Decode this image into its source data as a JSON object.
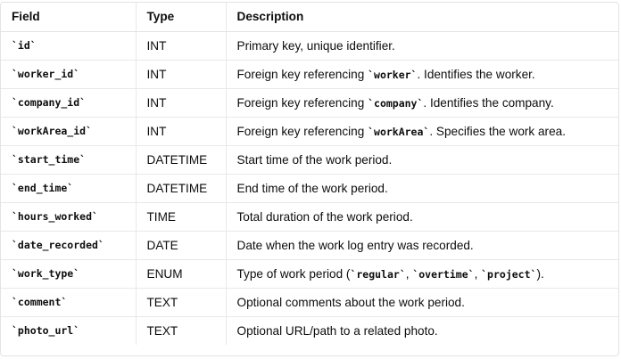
{
  "headers": {
    "field": "Field",
    "type": "Type",
    "description": "Description"
  },
  "rows": [
    {
      "field": "`id`",
      "type": "INT",
      "desc_parts": [
        {
          "t": "Primary key, unique identifier."
        }
      ]
    },
    {
      "field": "`worker_id`",
      "type": "INT",
      "desc_parts": [
        {
          "t": "Foreign key referencing "
        },
        {
          "t": "`worker`",
          "code": true
        },
        {
          "t": ". Identifies the worker."
        }
      ]
    },
    {
      "field": "`company_id`",
      "type": "INT",
      "desc_parts": [
        {
          "t": "Foreign key referencing "
        },
        {
          "t": "`company`",
          "code": true
        },
        {
          "t": ". Identifies the company."
        }
      ]
    },
    {
      "field": "`workArea_id`",
      "type": "INT",
      "desc_parts": [
        {
          "t": "Foreign key referencing "
        },
        {
          "t": "`workArea`",
          "code": true
        },
        {
          "t": ". Specifies the work area."
        }
      ]
    },
    {
      "field": "`start_time`",
      "type": "DATETIME",
      "desc_parts": [
        {
          "t": "Start time of the work period."
        }
      ]
    },
    {
      "field": "`end_time`",
      "type": "DATETIME",
      "desc_parts": [
        {
          "t": "End time of the work period."
        }
      ]
    },
    {
      "field": "`hours_worked`",
      "type": "TIME",
      "desc_parts": [
        {
          "t": "Total duration of the work period."
        }
      ]
    },
    {
      "field": "`date_recorded`",
      "type": "DATE",
      "desc_parts": [
        {
          "t": "Date when the work log entry was recorded."
        }
      ]
    },
    {
      "field": "`work_type`",
      "type": "ENUM",
      "desc_parts": [
        {
          "t": "Type of work period ("
        },
        {
          "t": "`regular`",
          "code": true
        },
        {
          "t": ", "
        },
        {
          "t": "`overtime`",
          "code": true
        },
        {
          "t": ", "
        },
        {
          "t": "`project`",
          "code": true
        },
        {
          "t": ")."
        }
      ]
    },
    {
      "field": "`comment`",
      "type": "TEXT",
      "desc_parts": [
        {
          "t": "Optional comments about the work period."
        }
      ]
    },
    {
      "field": "`photo_url`",
      "type": "TEXT",
      "desc_parts": [
        {
          "t": "Optional URL/path to a related photo."
        }
      ]
    }
  ]
}
